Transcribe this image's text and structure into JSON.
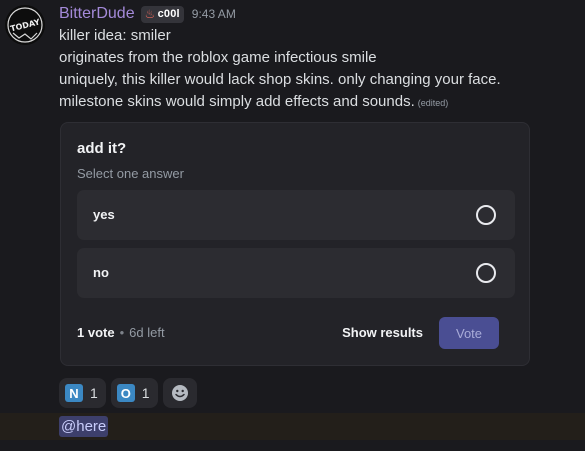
{
  "author": {
    "name": "BitterDude",
    "tag": "c00l",
    "timestamp": "9:43 AM",
    "avatar_text": "TODAY"
  },
  "message": {
    "lines": [
      "killer idea: smiler",
      "originates from the roblox game infectious smile",
      "uniquely, this killer would lack shop skins. only changing your face.",
      "milestone skins would simply add effects and sounds."
    ],
    "edited": "(edited)"
  },
  "poll": {
    "question": "add it?",
    "subtitle": "Select one answer",
    "answers": [
      {
        "label": "yes"
      },
      {
        "label": "no"
      }
    ],
    "vote_count": "1 vote",
    "separator": "•",
    "time_left": "6d left",
    "show_results_label": "Show results",
    "vote_label": "Vote"
  },
  "reactions": [
    {
      "emoji": "N",
      "count": "1"
    },
    {
      "emoji": "O",
      "count": "1"
    }
  ],
  "mention": "@here",
  "colors": {
    "username": "#a48ad9",
    "vote_button": "#4a4e93",
    "mention_bg": "#3d3f6b",
    "emoji_blue": "#3b88c3"
  }
}
